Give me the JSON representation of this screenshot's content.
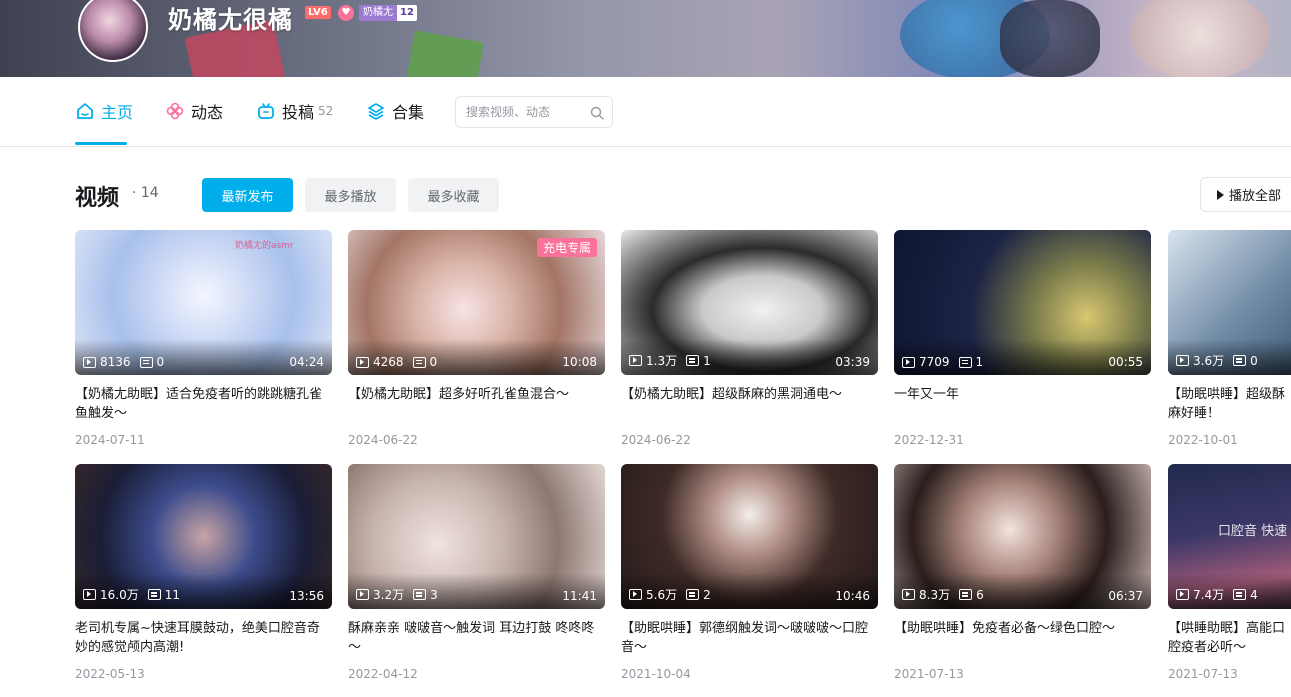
{
  "profile": {
    "name": "奶橘尢很橘",
    "level": "LV6",
    "fan_badge_name": "奶橘尢",
    "fan_badge_level": "12"
  },
  "nav": {
    "home": "主页",
    "dynamic": "动态",
    "uploads": "投稿",
    "uploads_count": "52",
    "collections": "合集",
    "search_placeholder": "搜索视频、动态"
  },
  "section": {
    "title": "视频",
    "count": "· 14",
    "tabs": [
      "最新发布",
      "最多播放",
      "最多收藏"
    ],
    "play_all": "播放全部"
  },
  "colors": {
    "accent": "#00aeec",
    "charge": "#fb7299"
  },
  "videos": [
    {
      "title": "【奶橘尢助眠】适合免疫者听的跳跳糖孔雀鱼触发～",
      "plays": "8136",
      "danmaku": "0",
      "duration": "04:24",
      "date": "2024-07-11",
      "overlay": "奶橘尢的asmr"
    },
    {
      "title": "【奶橘尢助眠】超多好听孔雀鱼混合～",
      "plays": "4268",
      "danmaku": "0",
      "duration": "10:08",
      "date": "2024-06-22",
      "badge": "充电专属"
    },
    {
      "title": "【奶橘尢助眠】超级酥麻的黑洞通电～",
      "plays": "1.3万",
      "danmaku": "1",
      "duration": "03:39",
      "date": "2024-06-22"
    },
    {
      "title": "一年又一年",
      "plays": "7709",
      "danmaku": "1",
      "duration": "00:55",
      "date": "2022-12-31"
    },
    {
      "title": "【助眠哄睡】超级酥麻好睡！",
      "plays": "3.6万",
      "danmaku": "0",
      "duration": "",
      "date": "2022-10-01"
    },
    {
      "title": "老司机专属~快速耳膜鼓动，绝美口腔音奇妙的感觉颅内高潮!",
      "plays": "16.0万",
      "danmaku": "11",
      "duration": "13:56",
      "date": "2022-05-13"
    },
    {
      "title": "酥麻亲亲 啵啵音～触发词 耳边打鼓 咚咚咚～",
      "plays": "3.2万",
      "danmaku": "3",
      "duration": "11:41",
      "date": "2022-04-12"
    },
    {
      "title": "【助眠哄睡】郭德纲触发词～啵啵啵～口腔音～",
      "plays": "5.6万",
      "danmaku": "2",
      "duration": "10:46",
      "date": "2021-10-04"
    },
    {
      "title": "【助眠哄睡】免疫者必备～绿色口腔～",
      "plays": "8.3万",
      "danmaku": "6",
      "duration": "06:37",
      "date": "2021-07-13"
    },
    {
      "title": "【哄睡助眠】高能口腔疫者必听～",
      "plays": "7.4万",
      "danmaku": "4",
      "duration": "",
      "date": "2021-07-13",
      "overlay": "口腔音 快速"
    }
  ]
}
